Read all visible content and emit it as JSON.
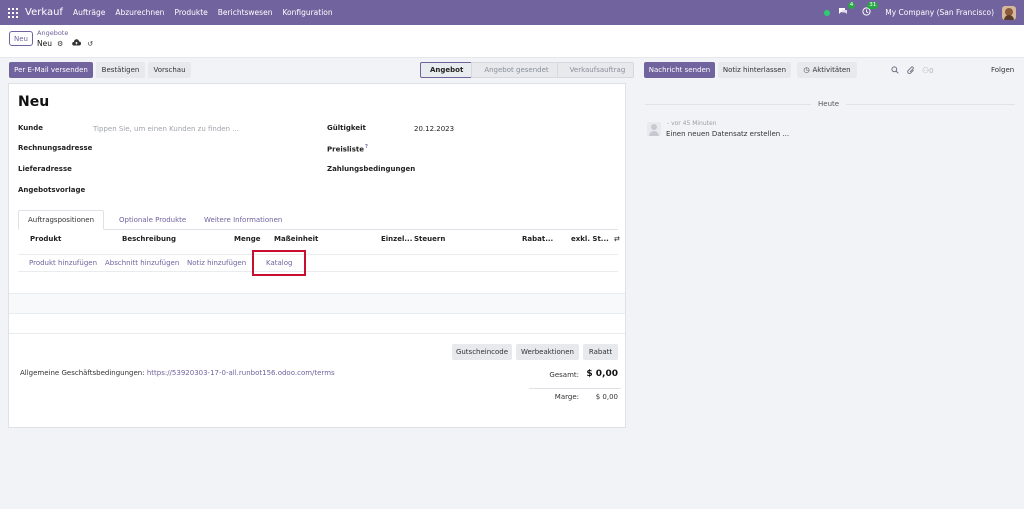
{
  "navbar": {
    "app_name": "Verkauf",
    "menu": [
      "Aufträge",
      "Abzurechnen",
      "Produkte",
      "Berichtswesen",
      "Konfiguration"
    ],
    "messages_badge": "4",
    "activities_badge": "31",
    "company": "My Company (San Francisco)"
  },
  "control": {
    "new_label": "Neu",
    "breadcrumb_parent": "Angebote",
    "breadcrumb_current": "Neu"
  },
  "actions": {
    "send_email": "Per E-Mail versenden",
    "confirm": "Bestätigen",
    "preview": "Vorschau"
  },
  "status_stages": [
    "Angebot",
    "Angebot gesendet",
    "Verkaufsauftrag"
  ],
  "form": {
    "title": "Neu",
    "customer_label": "Kunde",
    "customer_placeholder": "Tippen Sie, um einen Kunden zu finden ...",
    "invoice_address_label": "Rechnungsadresse",
    "delivery_address_label": "Lieferadresse",
    "template_label": "Angebotsvorlage",
    "validity_label": "Gültigkeit",
    "validity_value": "20.12.2023",
    "pricelist_label": "Preisliste",
    "pricelist_help": "?",
    "payment_terms_label": "Zahlungsbedingungen"
  },
  "tabs": [
    "Auftragspositionen",
    "Optionale Produkte",
    "Weitere Informationen"
  ],
  "table": {
    "columns": [
      "Produkt",
      "Beschreibung",
      "Menge",
      "Maßeinheit",
      "Einzel...",
      "Steuern",
      "Rabat...",
      "exkl. St..."
    ],
    "add_links": [
      "Produkt hinzufügen",
      "Abschnitt hinzufügen",
      "Notiz hinzufügen",
      "Katalog"
    ]
  },
  "footer": {
    "buttons": [
      "Gutscheincode",
      "Werbeaktionen",
      "Rabatt"
    ],
    "terms_label": "Allgemeine Geschäftsbedingungen: ",
    "terms_url": "https://53920303-17-0-all.runbot156.odoo.com/terms",
    "total_label": "Gesamt:",
    "total_value": "$ 0,00",
    "margin_label": "Marge:",
    "margin_value": "$ 0,00"
  },
  "chatter": {
    "send_message": "Nachricht senden",
    "log_note": "Notiz hinterlassen",
    "activities": "Aktivitäten",
    "follower_count": "0",
    "follow": "Folgen",
    "date_separator": "Heute",
    "message_time": "- vor 45 Minuten",
    "message_text": "Einen neuen Datensatz erstellen ..."
  },
  "icons": [
    "apps-grid-icon",
    "chat-icon",
    "clock-icon",
    "gear-icon",
    "cloud-upload-icon",
    "undo-icon",
    "search-icon",
    "paperclip-icon",
    "person-icon",
    "activity-clock-icon",
    "column-toggle-icon"
  ],
  "colors": {
    "brand": "#71639e",
    "highlight": "#c8102e",
    "online": "#2ecc71"
  }
}
